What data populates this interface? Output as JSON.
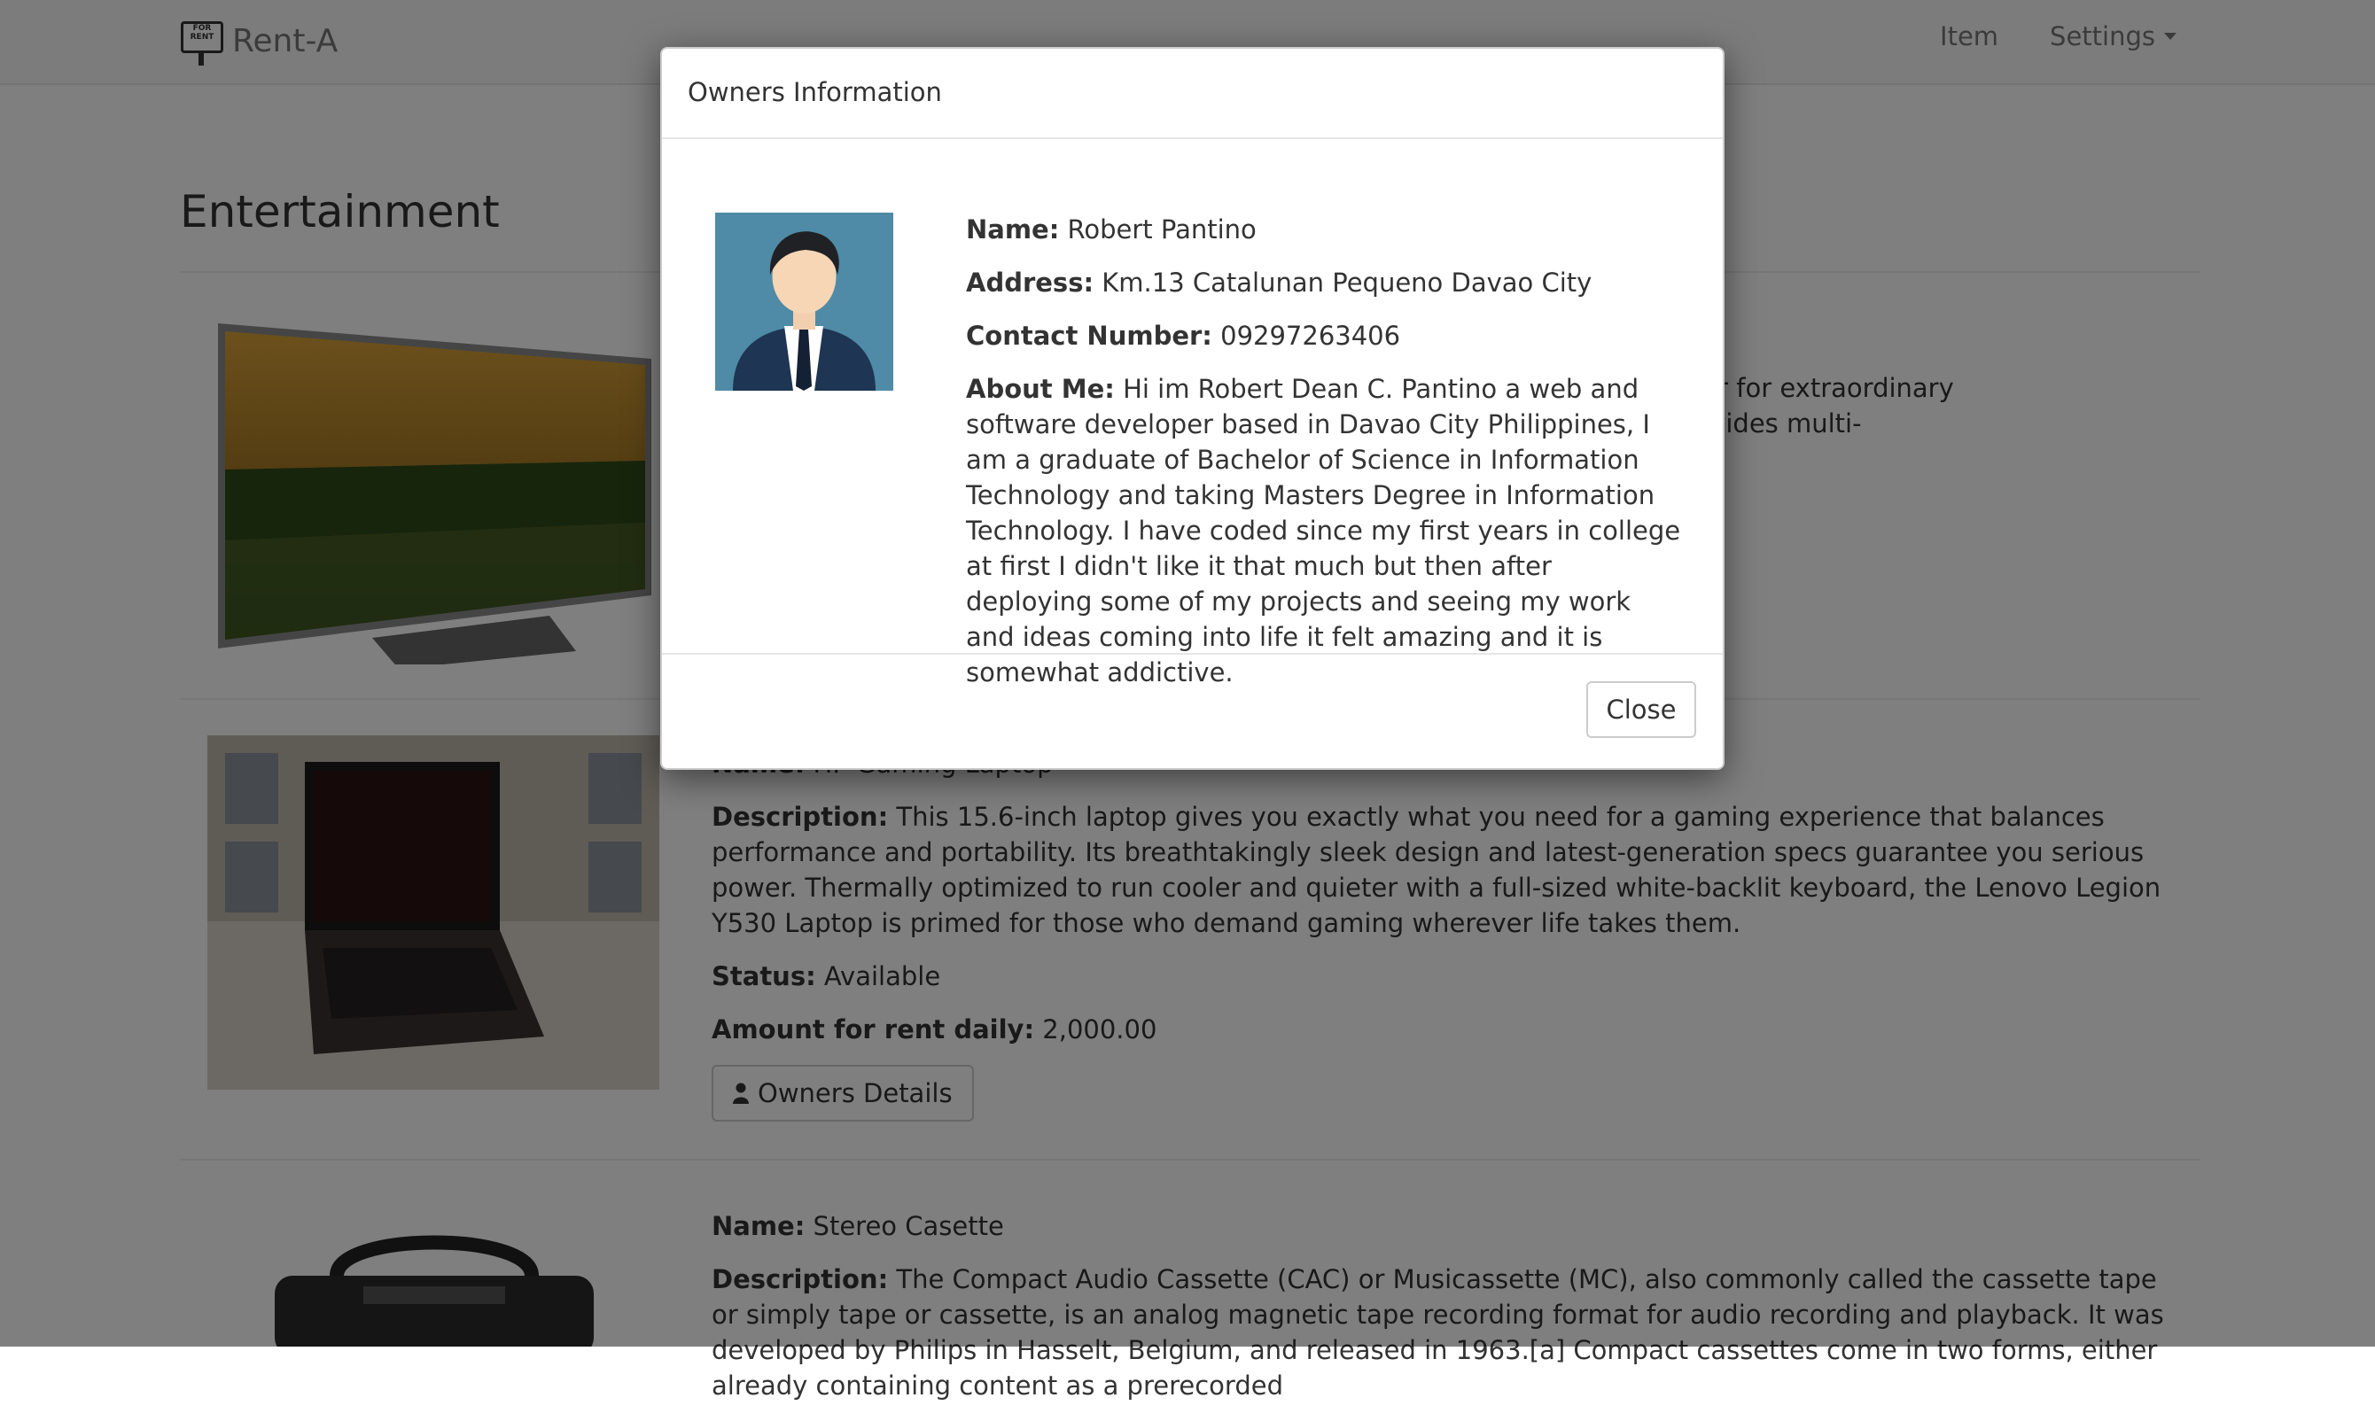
{
  "navbar": {
    "brand": "Rent-A",
    "logo_text": "FOR RENT",
    "item_link": "Item",
    "settings_link": "Settings"
  },
  "page": {
    "title": "Entertainment"
  },
  "items": [
    {
      "name": "HP Gaming Laptop",
      "description": "This 15.6-inch laptop gives you exactly what you need for a gaming experience that balances performance and portability. Its breathtakingly sleek design and latest-generation specs guarantee you serious power. Thermally optimized to run cooler and quieter with a full-sized white-backlit keyboard, the Lenovo Legion Y530 Laptop is primed for those who demand gaming wherever life takes them.",
      "status": "Available",
      "amount": "2,000.00"
    },
    {
      "name": "Stereo Casette",
      "description": "The Compact Audio Cassette (CAC) or Musicassette (MC), also commonly called the cassette tape or simply tape or cassette, is an analog magnetic tape recording format for audio recording and playback. It was developed by Philips in Hasselt, Belgium, and released in 1963.[a] Compact cassettes come in two forms, either already containing content as a prerecorded"
    }
  ],
  "tv_text_fragment_1": "ter™ optimizes color for extraordinary",
  "tv_text_fragment_2": "+™ technology provides multi-",
  "labels": {
    "name": "Name:",
    "description": "Description:",
    "status": "Status:",
    "amount": "Amount for rent daily:",
    "owners_details": "Owners Details"
  },
  "modal": {
    "title": "Owners Information",
    "name_label": "Name:",
    "name": "Robert Pantino",
    "address_label": "Address:",
    "address": "Km.13 Catalunan Pequeno Davao City",
    "contact_label": "Contact Number:",
    "contact": "09297263406",
    "about_label": "About Me:",
    "about": "Hi im Robert Dean C. Pantino a web and software developer based in Davao City Philippines, I am a graduate of Bachelor of Science in Information Technology and taking Masters Degree in Information Technology. I have coded since my first years in college at first I didn't like it that much but then after deploying some of my projects and seeing my work and ideas coming into life it felt amazing and it is somewhat addictive.",
    "close_label": "Close"
  }
}
